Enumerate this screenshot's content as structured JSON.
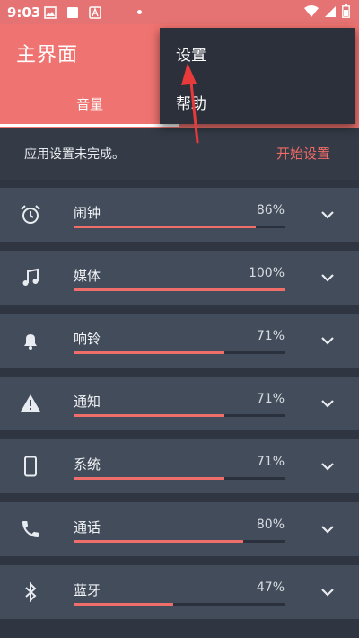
{
  "status": {
    "time": "9:03"
  },
  "app": {
    "title": "主界面",
    "tab": "音量"
  },
  "menu": {
    "items": [
      "设置",
      "帮助"
    ]
  },
  "notice": {
    "text": "应用设置未完成。",
    "action": "开始设置"
  },
  "volumes": [
    {
      "icon": "alarm-clock-icon",
      "label": "闹钟",
      "percent": "86%",
      "value": 86
    },
    {
      "icon": "music-note-icon",
      "label": "媒体",
      "percent": "100%",
      "value": 100
    },
    {
      "icon": "bell-icon",
      "label": "响铃",
      "percent": "71%",
      "value": 71
    },
    {
      "icon": "warning-icon",
      "label": "通知",
      "percent": "71%",
      "value": 71
    },
    {
      "icon": "phone-device-icon",
      "label": "系统",
      "percent": "71%",
      "value": 71
    },
    {
      "icon": "call-icon",
      "label": "通话",
      "percent": "80%",
      "value": 80
    },
    {
      "icon": "bluetooth-icon",
      "label": "蓝牙",
      "percent": "47%",
      "value": 47
    }
  ],
  "colors": {
    "accent": "#ef7370",
    "background": "#2f3541",
    "card": "#434c5b",
    "menu": "#2b303b"
  }
}
